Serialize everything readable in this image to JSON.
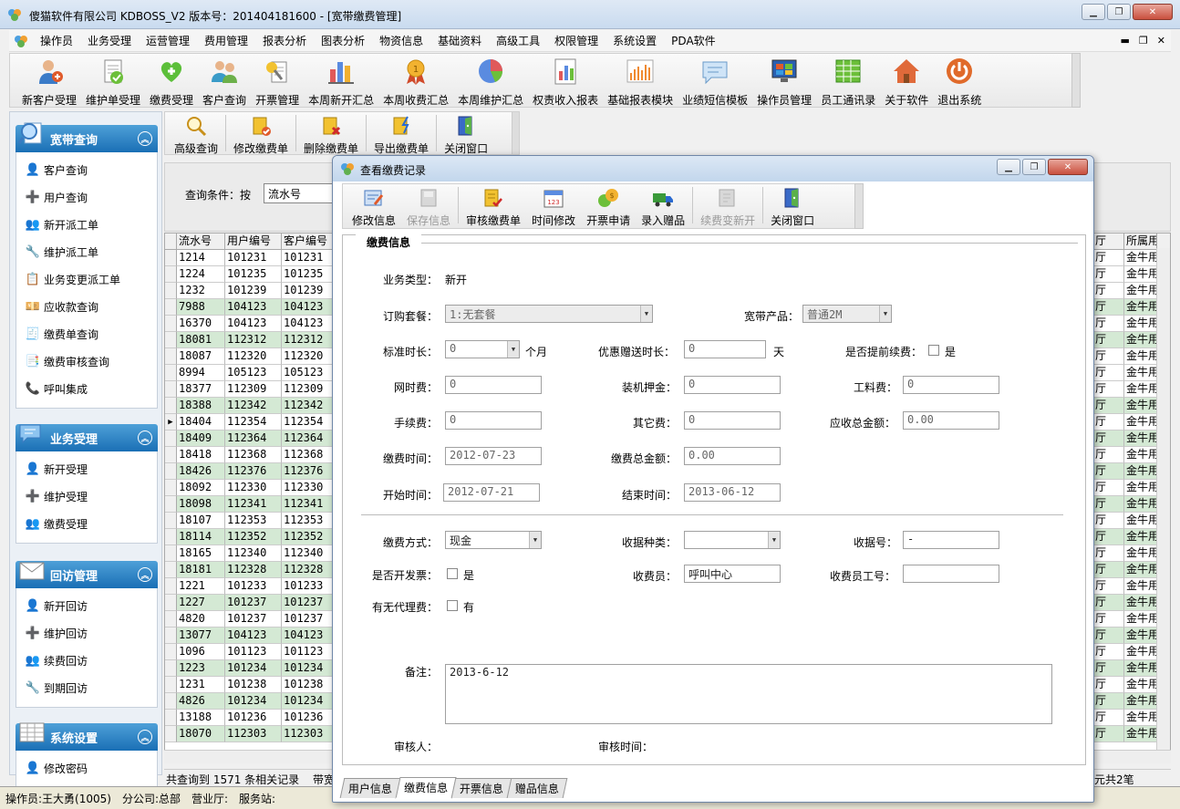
{
  "window": {
    "title": "傻猫软件有限公司    KDBOSS_V2    版本号：201404181600 - [宽带缴费管理]",
    "controls": [
      "min-icon",
      "restore-icon",
      "close-icon"
    ]
  },
  "menu": [
    "操作员",
    "业务受理",
    "运营管理",
    "费用管理",
    "报表分析",
    "图表分析",
    "物资信息",
    "基础资料",
    "高级工具",
    "权限管理",
    "系统设置",
    "PDA软件"
  ],
  "toolbar": [
    {
      "label": "新客户受理",
      "icon": "user-add-icon"
    },
    {
      "label": "维护单受理",
      "icon": "document-check-icon"
    },
    {
      "label": "缴费受理",
      "icon": "heart-plus-icon"
    },
    {
      "label": "客户查询",
      "icon": "users-icon"
    },
    {
      "label": "开票管理",
      "icon": "invoice-icon"
    },
    {
      "label": "本周新开汇总",
      "icon": "bar-chart-icon"
    },
    {
      "label": "本周收费汇总",
      "icon": "medal-icon"
    },
    {
      "label": "本周维护汇总",
      "icon": "pie-chart-icon"
    },
    {
      "label": "权责收入报表",
      "icon": "report-chart-icon"
    },
    {
      "label": "基础报表模块",
      "icon": "column-chart-icon"
    },
    {
      "label": "业绩短信模板",
      "icon": "message-icon"
    },
    {
      "label": "操作员管理",
      "icon": "monitor-icon"
    },
    {
      "label": "员工通讯录",
      "icon": "spreadsheet-icon"
    },
    {
      "label": "关于软件",
      "icon": "home-icon"
    },
    {
      "label": "退出系统",
      "icon": "power-icon"
    }
  ],
  "sidebar": {
    "groups": [
      {
        "title": "宽带查询",
        "items": [
          "客户查询",
          "用户查询",
          "新开派工单",
          "维护派工单",
          "业务变更派工单",
          "应收款查询",
          "缴费单查询",
          "缴费审核查询",
          "呼叫集成"
        ]
      },
      {
        "title": "业务受理",
        "items": [
          "新开受理",
          "维护受理",
          "缴费受理"
        ]
      },
      {
        "title": "回访管理",
        "items": [
          "新开回访",
          "维护回访",
          "续费回访",
          "到期回访"
        ]
      },
      {
        "title": "系统设置",
        "items": [
          "修改密码"
        ]
      }
    ]
  },
  "subtoolbar": [
    "高级查询",
    "修改缴费单",
    "删除缴费单",
    "导出缴费单",
    "关闭窗口"
  ],
  "query": {
    "label": "查询条件：按",
    "field": "流水号"
  },
  "grid": {
    "headers": [
      "流水号",
      "用户编号",
      "客户编号"
    ],
    "right_headers": [
      "厅",
      "所属用"
    ],
    "rows": [
      [
        "1214",
        "101231",
        "101231"
      ],
      [
        "1224",
        "101235",
        "101235"
      ],
      [
        "1232",
        "101239",
        "101239"
      ],
      [
        "7988",
        "104123",
        "104123"
      ],
      [
        "16370",
        "104123",
        "104123"
      ],
      [
        "18081",
        "112312",
        "112312"
      ],
      [
        "18087",
        "112320",
        "112320"
      ],
      [
        "8994",
        "105123",
        "105123"
      ],
      [
        "18377",
        "112309",
        "112309"
      ],
      [
        "18388",
        "112342",
        "112342"
      ],
      [
        "18404",
        "112354",
        "112354"
      ],
      [
        "18409",
        "112364",
        "112364"
      ],
      [
        "18418",
        "112368",
        "112368"
      ],
      [
        "18426",
        "112376",
        "112376"
      ],
      [
        "18092",
        "112330",
        "112330"
      ],
      [
        "18098",
        "112341",
        "112341"
      ],
      [
        "18107",
        "112353",
        "112353"
      ],
      [
        "18114",
        "112352",
        "112352"
      ],
      [
        "18165",
        "112340",
        "112340"
      ],
      [
        "18181",
        "112328",
        "112328"
      ],
      [
        "1221",
        "101233",
        "101233"
      ],
      [
        "1227",
        "101237",
        "101237"
      ],
      [
        "4820",
        "101237",
        "101237"
      ],
      [
        "13077",
        "104123",
        "104123"
      ],
      [
        "1096",
        "101123",
        "101123"
      ],
      [
        "1223",
        "101234",
        "101234"
      ],
      [
        "1231",
        "101238",
        "101238"
      ],
      [
        "4826",
        "101234",
        "101234"
      ],
      [
        "13188",
        "101236",
        "101236"
      ],
      [
        "18070",
        "112303",
        "112303"
      ]
    ],
    "right_cells": [
      "厅",
      "金牛用"
    ],
    "current_row": 10
  },
  "count_text": "共查询到 1571 条相关记录",
  "count_tail": "带宽",
  "count_right": "元共2笔",
  "statusbar": [
    "操作员:王大勇(1005)",
    "分公司:总部",
    "营业厅:",
    "服务站:"
  ],
  "dialog": {
    "title": "查看缴费记录",
    "toolbar": [
      {
        "label": "修改信息",
        "enabled": true,
        "icon": "edit-icon"
      },
      {
        "label": "保存信息",
        "enabled": false,
        "icon": "save-icon"
      },
      {
        "label": "审核缴费单",
        "enabled": true,
        "icon": "audit-icon"
      },
      {
        "label": "时间修改",
        "enabled": true,
        "icon": "calendar-icon"
      },
      {
        "label": "开票申请",
        "enabled": true,
        "icon": "coins-icon"
      },
      {
        "label": "录入赠品",
        "enabled": true,
        "icon": "truck-icon"
      },
      {
        "label": "续费变新开",
        "enabled": false,
        "icon": "renew-icon"
      },
      {
        "label": "关闭窗口",
        "enabled": true,
        "icon": "door-icon"
      }
    ],
    "section": "缴费信息",
    "fields": {
      "biz_type_label": "业务类型：",
      "biz_type": "新开",
      "package_label": "订购套餐：",
      "package": "1:无套餐",
      "product_label": "宽带产品：",
      "product": "普通2M",
      "std_duration_label": "标准时长：",
      "std_duration": "0",
      "std_duration_unit": "个月",
      "bonus_label": "优惠赠送时长：",
      "bonus": "0",
      "bonus_unit": "天",
      "early_label": "是否提前续费：",
      "early_text": "是",
      "net_fee_label": "网时费：",
      "net_fee": "0",
      "deposit_label": "装机押金：",
      "deposit": "0",
      "material_label": "工料费：",
      "material": "0",
      "handling_label": "手续费：",
      "handling": "0",
      "other_label": "其它费：",
      "other": "0",
      "receivable_label": "应收总金额：",
      "receivable": "0.00",
      "pay_time_label": "缴费时间：",
      "pay_time": "2012-07-23",
      "total_label": "缴费总金额：",
      "total": "0.00",
      "start_label": "开始时间：",
      "start": "2012-07-21",
      "end_label": "结束时间：",
      "end": "2013-06-12",
      "pay_method_label": "缴费方式：",
      "pay_method": "现金",
      "receipt_type_label": "收据种类：",
      "receipt_type": "",
      "receipt_no_label": "收据号：",
      "receipt_no": "-",
      "invoice_label": "是否开发票：",
      "invoice_text": "是",
      "collector_label": "收费员：",
      "collector": "呼叫中心",
      "collector_id_label": "收费员工号：",
      "collector_id": "",
      "agent_label": "有无代理费：",
      "agent_text": "有",
      "remark_label": "备注：",
      "remark": "2013-6-12",
      "auditor_label": "审核人：",
      "audit_time_label": "审核时间："
    },
    "tabs": [
      "用户信息",
      "缴费信息",
      "开票信息",
      "赠品信息"
    ],
    "active_tab": 1
  }
}
